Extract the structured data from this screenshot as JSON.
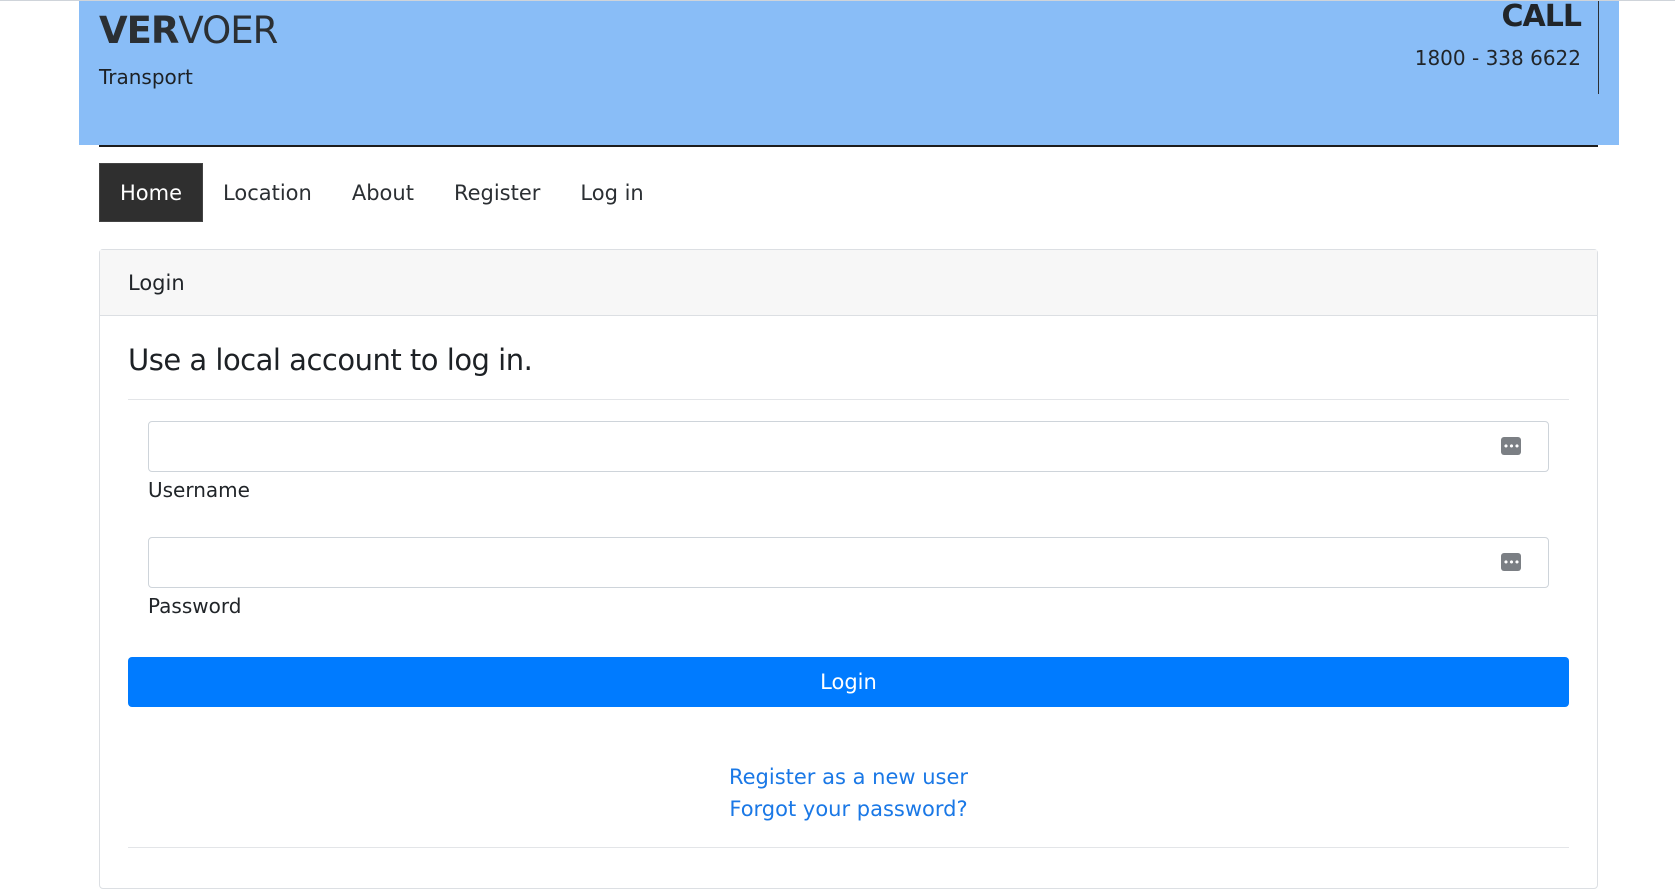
{
  "header": {
    "brand_bold": "VER",
    "brand_light": "VOER",
    "tagline": "Transport",
    "call_label": "CALL",
    "call_number": "1800 - 338 6622",
    "background_color": "#89bdf7"
  },
  "nav": {
    "items": [
      {
        "label": "Home",
        "active": true
      },
      {
        "label": "Location",
        "active": false
      },
      {
        "label": "About",
        "active": false
      },
      {
        "label": "Register",
        "active": false
      },
      {
        "label": "Log in",
        "active": false
      }
    ]
  },
  "login_card": {
    "header": "Login",
    "title": "Use a local account to log in.",
    "username": {
      "label": "Username",
      "value": "",
      "icon": "password-manager-icon"
    },
    "password": {
      "label": "Password",
      "value": "",
      "icon": "password-manager-icon"
    },
    "submit_label": "Login",
    "submit_color": "#007bff",
    "links": {
      "register": "Register as a new user",
      "forgot": "Forgot your password?"
    }
  }
}
